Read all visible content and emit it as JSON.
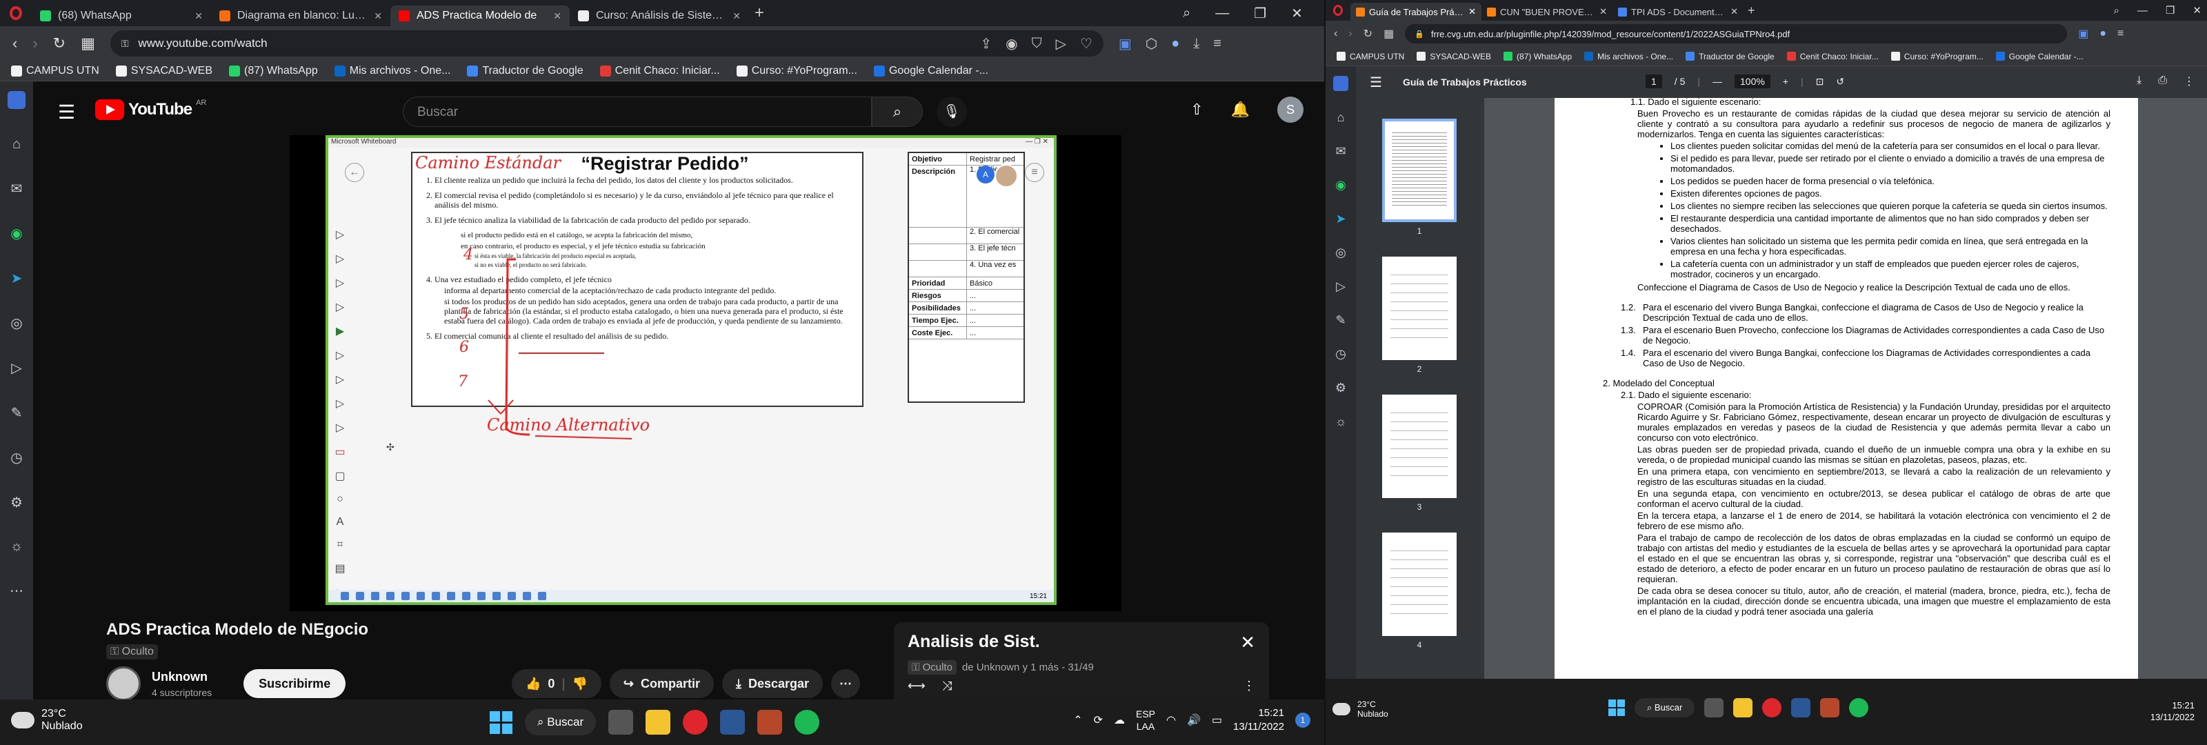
{
  "left": {
    "tabs": [
      {
        "title": "(68) WhatsApp",
        "color": "#25d366"
      },
      {
        "title": "Diagrama en blanco: Lucid",
        "color": "#f96b13"
      },
      {
        "title": "ADS Practica Modelo de",
        "color": "#ff0000",
        "active": true
      },
      {
        "title": "Curso: Análisis de Sistemas",
        "color": "#eeeeee"
      }
    ],
    "url": "www.youtube.com/watch",
    "bookmarks": [
      {
        "label": "CAMPUS UTN",
        "color": "#f2f2f2"
      },
      {
        "label": "SYSACAD-WEB",
        "color": "#f2f2f2"
      },
      {
        "label": "(87) WhatsApp",
        "color": "#25d366"
      },
      {
        "label": "Mis archivos - One...",
        "color": "#0a66c2"
      },
      {
        "label": "Traductor de Google",
        "color": "#4285f4"
      },
      {
        "label": "Cenit Chaco: Iniciar...",
        "color": "#e53935"
      },
      {
        "label": "Curso: #YoProgram...",
        "color": "#f2f2f2"
      },
      {
        "label": "Google Calendar -...",
        "color": "#1a73e8"
      }
    ],
    "youtube": {
      "logo_text": "YouTube",
      "country": "AR",
      "search_placeholder": "Buscar",
      "avatar_letter": "S",
      "video_title": "ADS Practica Modelo de NEgocio",
      "visibility": "Oculto",
      "channel_name": "Unknown",
      "channel_subs": "4 suscriptores",
      "subscribe_label": "Suscribirme",
      "likes": "0",
      "share_label": "Compartir",
      "download_label": "Descargar",
      "playlist_title": "Analisis de Sist.",
      "playlist_visibility": "Oculto",
      "playlist_sub": "de Unknown y 1 más - 31/49"
    },
    "whiteboard": {
      "app_title": "Microsoft Whiteboard",
      "doc_title": "“Registrar Pedido”",
      "red_top": "Camino Estándar",
      "red_bottom": "Camino Alternativo",
      "steps": [
        "El cliente realiza un pedido que incluirá la fecha del pedido, los datos del cliente y los productos solicitados.",
        "El comercial revisa el pedido (completándolo si es necesario) y le da curso, enviándolo al jefe técnico para que realice el análisis del mismo.",
        "El jefe técnico analiza la viabilidad de la fabricación de cada producto del pedido por separado.",
        "Una vez estudiado el pedido completo, el jefe técnico",
        "El comercial comunica al cliente el resultado del análisis de su pedido."
      ],
      "step3_subs": [
        "si el producto pedido está en el catálogo, se acepta la fabricación del mismo,",
        "en caso contrario, el producto es especial, y el jefe técnico estudia su fabricación",
        "si ésta es viable, la fabricación del producto especial es aceptada,",
        "si no es viable, el producto no será fabricado."
      ],
      "step4_subs": [
        "informa al departamento comercial de la aceptación/rechazo de cada producto integrante del pedido.",
        "si todos los productos de un pedido han sido aceptados, genera una orden de trabajo para cada producto, a partir de una plantilla de fabricación (la estándar, si el producto estaba catalogado, o bien una nueva generada para el producto, si éste estaba fuera del catálogo). Cada orden de trabajo es enviada al jefe de producción, y queda pendiente de su lanzamiento."
      ],
      "table_rows": [
        {
          "k": "Objetivo",
          "v": "Registrar ped"
        },
        {
          "k": "Descripción",
          "v": "1. El cliente"
        },
        {
          "k": "",
          "v": "2. El comercial"
        },
        {
          "k": "",
          "v": "3. El jefe técn"
        },
        {
          "k": "",
          "v": "4. Una vez es"
        },
        {
          "k": "Prioridad",
          "v": "Básico"
        },
        {
          "k": "Riesgos",
          "v": "..."
        },
        {
          "k": "Posibilidades",
          "v": "..."
        },
        {
          "k": "Tiempo Ejec.",
          "v": "..."
        },
        {
          "k": "Coste Ejec.",
          "v": "..."
        }
      ],
      "mini_clock": "15:21"
    },
    "taskbar": {
      "temp": "23°C",
      "weather": "Nublado",
      "search": "Buscar",
      "lang1": "ESP",
      "lang2": "LAA",
      "time": "15:21",
      "date": "13/11/2022",
      "notifications": "1"
    }
  },
  "right": {
    "tabs": [
      {
        "title": "Guía de Trabajos Prácticos",
        "color": "#f98012",
        "active": true
      },
      {
        "title": "CUN \"BUEN PROVECHO\"",
        "color": "#f98012"
      },
      {
        "title": "TPI ADS - Documentos de",
        "color": "#4285f4"
      }
    ],
    "url": "frre.cvg.utn.edu.ar/pluginfile.php/142039/mod_resource/content/1/2022ASGuiaTPNro4.pdf",
    "bookmarks": [
      {
        "label": "CAMPUS UTN",
        "color": "#f2f2f2"
      },
      {
        "label": "SYSACAD-WEB",
        "color": "#f2f2f2"
      },
      {
        "label": "(87) WhatsApp",
        "color": "#25d366"
      },
      {
        "label": "Mis archivos - One...",
        "color": "#0a66c2"
      },
      {
        "label": "Traductor de Google",
        "color": "#4285f4"
      },
      {
        "label": "Cenit Chaco: Iniciar...",
        "color": "#e53935"
      },
      {
        "label": "Curso: #YoProgram...",
        "color": "#f2f2f2"
      },
      {
        "label": "Google Calendar -...",
        "color": "#1a73e8"
      }
    ],
    "pdf": {
      "title": "Guía de Trabajos Prácticos",
      "page": "1",
      "pages_total": "/ 5",
      "zoom": "100%",
      "thumbs": [
        "1",
        "2",
        "3",
        "4"
      ],
      "intro_cut": "1.1. Dado el siguiente escenario:",
      "p1": "Buen Provecho es un restaurante de comidas rápidas de la ciudad que desea mejorar su servicio de atención al cliente y contrató a su consultora para ayudarlo a redefinir sus procesos de negocio de manera de agilizarlos y modernizarlos. Tenga en cuenta las siguientes características:",
      "bullets": [
        "Los clientes pueden solicitar comidas del menú de la cafetería para ser consumidos en el local o para llevar.",
        "Si el pedido es para llevar, puede ser retirado por el cliente o enviado a domicilio a través de una empresa de motomandados.",
        "Los pedidos se pueden hacer de forma presencial o vía telefónica.",
        "Existen diferentes opciones de pagos.",
        "Los clientes no siempre reciben las selecciones que quieren porque la cafetería se queda sin ciertos insumos.",
        "El restaurante desperdicia una cantidad importante de alimentos que no han sido comprados y deben ser desechados.",
        "Varios clientes han solicitado un sistema que les permita pedir comida en línea, que será entregada en la empresa en una fecha y hora especificadas.",
        "La cafetería cuenta con un administrador y un staff de empleados que pueden ejercer roles de cajeros, mostrador, cocineros y un encargado."
      ],
      "p2": "Confeccione el Diagrama de Casos de Uso de Negocio y realice la Descripción Textual de cada uno de ellos.",
      "items": [
        {
          "n": "1.2.",
          "t": "Para el escenario del vivero Bunga Bangkai, confeccione el diagrama de Casos de Uso de Negocio y realice la Descripción Textual de cada uno de ellos."
        },
        {
          "n": "1.3.",
          "t": "Para el escenario Buen Provecho, confeccione los Diagramas de Actividades correspondientes a cada Caso de Uso de Negocio."
        },
        {
          "n": "1.4.",
          "t": "Para el escenario del vivero Bunga Bangkai, confeccione los Diagramas de Actividades correspondientes a cada Caso de Uso de Negocio."
        }
      ],
      "section2": "2.   Modelado del Conceptual",
      "s21": "2.1. Dado el siguiente escenario:",
      "paras": [
        "COPROAR (Comisión para la Promoción Artística de Resistencia) y la Fundación Urunday, presididas por el arquitecto Ricardo Aguirre y Sr. Fabriciano Gómez, respectivamente, desean encarar un proyecto de divulgación de esculturas y murales emplazados en veredas y paseos de la ciudad de Resistencia y que además permita llevar a cabo un concurso con voto electrónico.",
        "Las obras pueden ser de propiedad privada, cuando el dueño de un inmueble compra una obra y la exhibe en su vereda, o de propiedad municipal cuando las mismas se sitúan en plazoletas, paseos, plazas, etc.",
        "En una primera etapa, con vencimiento en septiembre/2013, se llevará a cabo la realización de un relevamiento y registro de las esculturas situadas en la ciudad.",
        "En una segunda etapa, con vencimiento en octubre/2013, se desea publicar el catálogo de obras de arte que conforman el acervo cultural de la ciudad.",
        "En la tercera etapa, a lanzarse el 1 de enero de 2014, se habilitará la votación electrónica con vencimiento el 2 de febrero de ese mismo año.",
        "Para el trabajo de campo de recolección de los datos de obras emplazadas en la ciudad se conformó un equipo de trabajo con artistas del medio y estudiantes de la escuela de bellas artes y se aprovechará la oportunidad para captar el estado en el que se encuentran las obras y, si corresponde, registrar una \"observación\" que describa cuál es el estado de deterioro, a efecto de poder encarar en un futuro un proceso paulatino de restauración de obras que así lo requieran.",
        "De cada obra se desea conocer su título, autor, año de creación, el material (madera, bronce, piedra, etc.), fecha de implantación en la ciudad, dirección donde se encuentra ubicada, una imagen que muestre el emplazamiento de esta en el plano de la ciudad y podrá tener asociada una galería"
      ]
    },
    "taskbar": {
      "temp": "23°C",
      "weather": "Nublado",
      "search": "Buscar",
      "time": "15:21",
      "date": "13/11/2022"
    }
  }
}
